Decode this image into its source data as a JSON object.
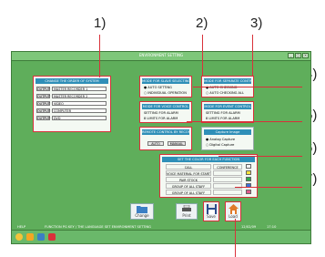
{
  "annotations": [
    "1)",
    "2)",
    "3)",
    "4)",
    "5)",
    "6)",
    "7)"
  ],
  "window": {
    "title": "ENVIRONMENT SETTING"
  },
  "order_panel": {
    "header": "CHANGE THE ORDER OF SYSTEM",
    "rows": [
      {
        "btn": "OUTPUT",
        "value": "MASTER RECORDER 1"
      },
      {
        "btn": "OUTPUT",
        "value": "MASTER RECORDER 2"
      },
      {
        "btn": "OUTPUT",
        "value": "VIDEO"
      },
      {
        "btn": "OUTPUT",
        "value": "COMPUTER"
      },
      {
        "btn": "OUTPUT",
        "value": "DVD"
      }
    ]
  },
  "slave_panel": {
    "header": "MODE FOR SLAVE SELECTING",
    "options": [
      "AUTO SETTING",
      "INDIVIDUAL OPERATION"
    ]
  },
  "separate_panel": {
    "header": "MODE FOR SEPARATE CONTROL",
    "options": [
      "AUTO CHECKING",
      "AUTO CHECKING ALL"
    ]
  },
  "voice_panel": {
    "header": "MODE FOR VOICE CONTROL",
    "lines": [
      "SETTING FOR ALARM",
      "8 LIMITS FOR ALARM"
    ]
  },
  "event_panel": {
    "header": "MODE FOR EVENT CONTROL",
    "lines": [
      "SETTING FOR ALARM",
      "8 LIMITS FOR ALARM"
    ]
  },
  "remote_panel": {
    "label": "REMOTE CONTROL BY RECORDER",
    "buttons": [
      "AUTO",
      "MANUAL"
    ]
  },
  "capture": {
    "header": "Capture Image",
    "options": [
      "Analog Capture",
      "Digital Capture"
    ]
  },
  "color_panel": {
    "header": "SET THE COLOR FOR EACH FUNCTION",
    "rows": [
      {
        "label": "CALL",
        "value": "CONFERENCE",
        "color": "#f4f4f4"
      },
      {
        "label": "VOICE MATERIAL FOR STARTING",
        "value": "",
        "color": "#f6e13a"
      },
      {
        "label": "PAIR STOCK",
        "value": "",
        "color": "#2ea84e"
      },
      {
        "label": "GROUP OF ALL STAFF",
        "value": "",
        "color": "#3a6fd8"
      },
      {
        "label": "GROUP OF ALL STAFF",
        "value": "",
        "color": "#e05a8a"
      }
    ]
  },
  "bottom_buttons": [
    {
      "label": "Change",
      "icon": "folder-icon"
    },
    {
      "label": "Print",
      "icon": "printer-icon"
    },
    {
      "label": "Save",
      "icon": "floppy-disk-icon"
    },
    {
      "label": "Load",
      "icon": "house-icon"
    }
  ],
  "status_bar": {
    "left": "HELP",
    "message": "FUNCTION PG KEY / THE LANGUAGE SET ENVIRONMENT SETTING",
    "date": "12/02/09",
    "time": "17:10"
  },
  "colors": {
    "accent_red": "#d9313a",
    "window_green": "#5fae5b",
    "header_blue": "#2f8fb8"
  }
}
